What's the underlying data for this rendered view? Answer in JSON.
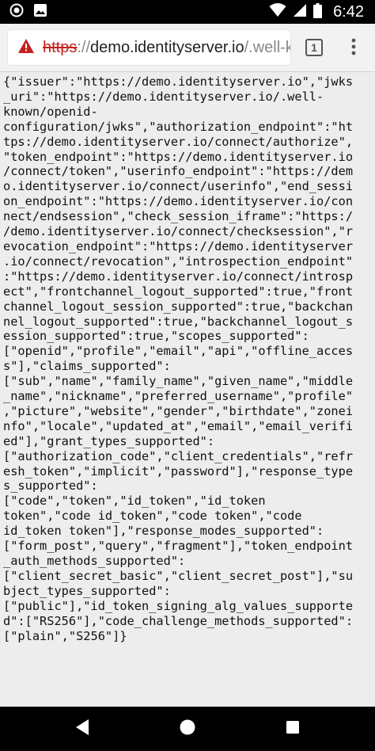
{
  "status_bar": {
    "time": "6:42",
    "icons": [
      "circle-notification-icon",
      "image-notification-icon",
      "wifi-icon",
      "cellular-icon",
      "battery-icon"
    ]
  },
  "browser": {
    "url": {
      "scheme": "https",
      "separator": "://",
      "domain": "demo.identityserver.io",
      "path": "/.well-kn"
    },
    "tab_count": "1",
    "security_status": "not-secure",
    "accent_color": "#c5221f"
  },
  "page": {
    "lines": [
      "{\"issuer\":\"https://demo.identityserver.io\",\"jwks",
      "_uri\":\"https://demo.identityserver.io/.well-",
      "known/openid-",
      "configuration/jwks\",\"authorization_endpoint\":\"ht",
      "tps://demo.identityserver.io/connect/authorize\",",
      "\"token_endpoint\":\"https://demo.identityserver.io",
      "/connect/token\",\"userinfo_endpoint\":\"https://dem",
      "o.identityserver.io/connect/userinfo\",\"end_sessi",
      "on_endpoint\":\"https://demo.identityserver.io/con",
      "nect/endsession\",\"check_session_iframe\":\"https:/",
      "/demo.identityserver.io/connect/checksession\",\"r",
      "evocation_endpoint\":\"https://demo.identityserver",
      ".io/connect/revocation\",\"introspection_endpoint\"",
      ":\"https://demo.identityserver.io/connect/introsp",
      "ect\",\"frontchannel_logout_supported\":true,\"front",
      "channel_logout_session_supported\":true,\"backchan",
      "nel_logout_supported\":true,\"backchannel_logout_s",
      "ession_supported\":true,\"scopes_supported\":",
      "[\"openid\",\"profile\",\"email\",\"api\",\"offline_acces",
      "s\"],\"claims_supported\":",
      "[\"sub\",\"name\",\"family_name\",\"given_name\",\"middle",
      "_name\",\"nickname\",\"preferred_username\",\"profile\"",
      ",\"picture\",\"website\",\"gender\",\"birthdate\",\"zonei",
      "nfo\",\"locale\",\"updated_at\",\"email\",\"email_verifi",
      "ed\"],\"grant_types_supported\":",
      "[\"authorization_code\",\"client_credentials\",\"refr",
      "esh_token\",\"implicit\",\"password\"],\"response_type",
      "s_supported\":",
      "[\"code\",\"token\",\"id_token\",\"id_token",
      "token\",\"code id_token\",\"code token\",\"code",
      "id_token token\"],\"response_modes_supported\":",
      "[\"form_post\",\"query\",\"fragment\"],\"token_endpoint",
      "_auth_methods_supported\":",
      "[\"client_secret_basic\",\"client_secret_post\"],\"su",
      "bject_types_supported\":",
      "[\"public\"],\"id_token_signing_alg_values_supporte",
      "d\":[\"RS256\"],\"code_challenge_methods_supported\":",
      "[\"plain\",\"S256\"]}"
    ]
  },
  "nav_bar": {
    "icons": [
      "back-icon",
      "home-icon",
      "recents-icon"
    ]
  }
}
